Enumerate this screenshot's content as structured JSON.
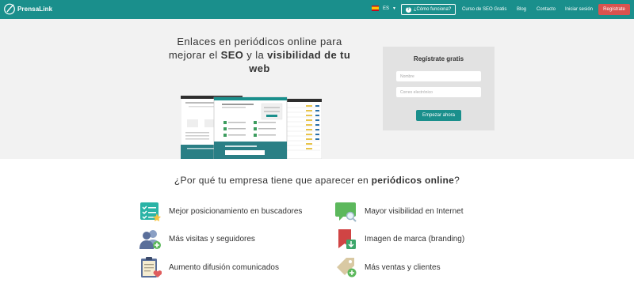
{
  "nav": {
    "logo_text": "PrensaLink",
    "lang_code": "ES",
    "how_it_works": "¿Cómo funciona?",
    "links": [
      "Curso de SEO Gratis",
      "Blog",
      "Contacto",
      "Iniciar sesión"
    ],
    "register": "Regístrate"
  },
  "hero": {
    "headline_pre": "Enlaces en periódicos online para mejorar el ",
    "headline_bold1": "SEO",
    "headline_mid": " y la ",
    "headline_bold2": "visibilidad de tu web"
  },
  "signup": {
    "title": "Regístrate gratis",
    "name_placeholder": "Nombre",
    "email_placeholder": "Correo electrónico",
    "submit": "Empezar ahora"
  },
  "why": {
    "title_pre": "¿Por qué tu empresa tiene que aparecer en ",
    "title_bold": "periódicos online",
    "title_post": "?",
    "features": [
      {
        "label": "Mejor posicionamiento en buscadores",
        "icon": "checklist-icon"
      },
      {
        "label": "Mayor visibilidad en Internet",
        "icon": "speech-search-icon"
      },
      {
        "label": "Más visitas y seguidores",
        "icon": "users-add-icon"
      },
      {
        "label": "Imagen de marca (branding)",
        "icon": "bookmark-download-icon"
      },
      {
        "label": "Aumento difusión comunicados",
        "icon": "clipboard-heart-icon"
      },
      {
        "label": "Más ventas y clientes",
        "icon": "price-tag-add-icon"
      }
    ]
  },
  "colors": {
    "brand": "#1a8f8c",
    "register": "#d9534f",
    "hero_bg": "#f2f2f2",
    "form_bg": "#e2e2e2"
  }
}
